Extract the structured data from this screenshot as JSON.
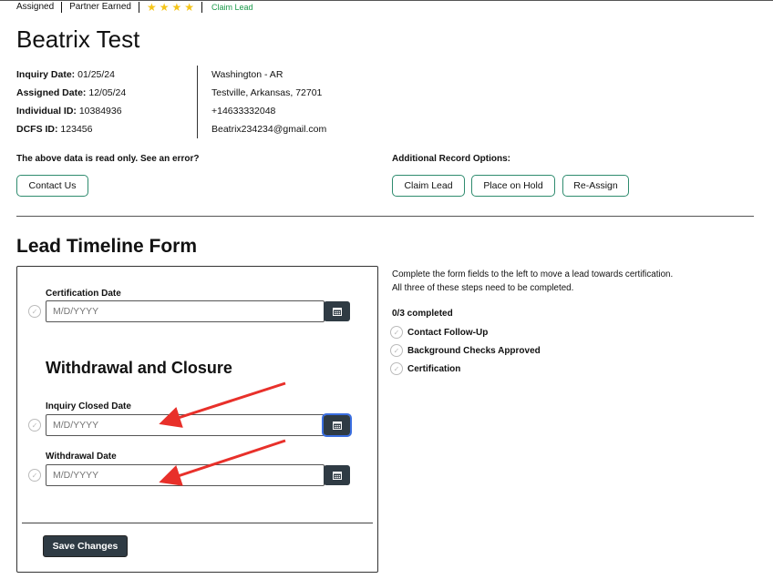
{
  "topbar": {
    "status": "Assigned",
    "partner": "Partner Earned",
    "rating": 4,
    "claim_link": "Claim Lead"
  },
  "lead": {
    "name": "Beatrix Test",
    "inquiry_label": "Inquiry Date:",
    "inquiry_value": "01/25/24",
    "assigned_label": "Assigned Date:",
    "assigned_value": "12/05/24",
    "individual_label": "Individual ID:",
    "individual_value": "10384936",
    "dcfs_label": "DCFS ID:",
    "dcfs_value": "123456",
    "location": "Washington - AR",
    "address": "Testville, Arkansas, 72701",
    "phone": "+14633332048",
    "email": "Beatrix234234@gmail.com"
  },
  "notes": {
    "read_only": "The above data is read only. See an error?",
    "additional": "Additional Record Options:"
  },
  "buttons": {
    "contact": "Contact Us",
    "claim": "Claim Lead",
    "hold": "Place on Hold",
    "reassign": "Re-Assign",
    "save": "Save Changes"
  },
  "form": {
    "title": "Lead Timeline Form",
    "cert_label": "Certification Date",
    "cert_placeholder": "M/D/YYYY",
    "withdrawal_heading": "Withdrawal and Closure",
    "closed_label": "Inquiry Closed Date",
    "closed_placeholder": "M/D/YYYY",
    "withdrawal_label": "Withdrawal Date",
    "withdrawal_placeholder": "M/D/YYYY"
  },
  "progress": {
    "line1": "Complete the form fields to the left to move a lead towards certification.",
    "line2": "All three of these steps need to be completed.",
    "count": "0/3 completed",
    "steps": [
      "Contact Follow-Up",
      "Background Checks Approved",
      "Certification"
    ]
  },
  "colors": {
    "accent_green": "#2e8b6e",
    "link_green": "#1a9a4a",
    "star": "#f5c518",
    "dark_button": "#2f3b44",
    "annotation_arrow": "#e8302a"
  },
  "icons": {
    "star": "star-icon",
    "calendar": "calendar-icon",
    "check": "check-circle-icon"
  }
}
